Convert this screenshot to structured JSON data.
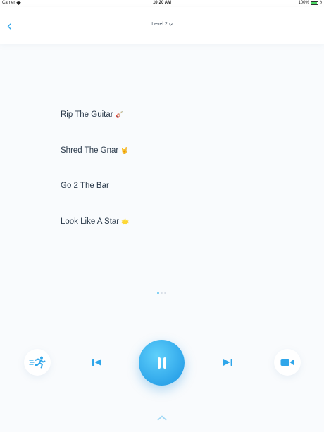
{
  "status_bar": {
    "carrier": "Carrier",
    "time": "10:20 AM",
    "battery_percent": "100%",
    "battery_level": 1.0
  },
  "nav": {
    "title": "Level 2",
    "title_chevron": "⌄"
  },
  "lyrics": [
    {
      "text": "Rip The Guitar",
      "emoji": "🎸"
    },
    {
      "text": "Shred The Gnar",
      "emoji": "🤘"
    },
    {
      "text": "Go 2 The Bar",
      "emoji": ""
    },
    {
      "text": "Look Like A Star",
      "emoji": "🌟"
    }
  ],
  "pager": {
    "count": 3,
    "active": 0
  },
  "controls": {
    "runner_icon": "running-person-icon",
    "prev_icon": "skip-previous-icon",
    "pause_icon": "pause-icon",
    "next_icon": "skip-next-icon",
    "video_icon": "video-camera-icon"
  },
  "colors": {
    "accent": "#2fa6ea",
    "accent_light": "#5fd0fb",
    "text": "#2c3b4c"
  }
}
